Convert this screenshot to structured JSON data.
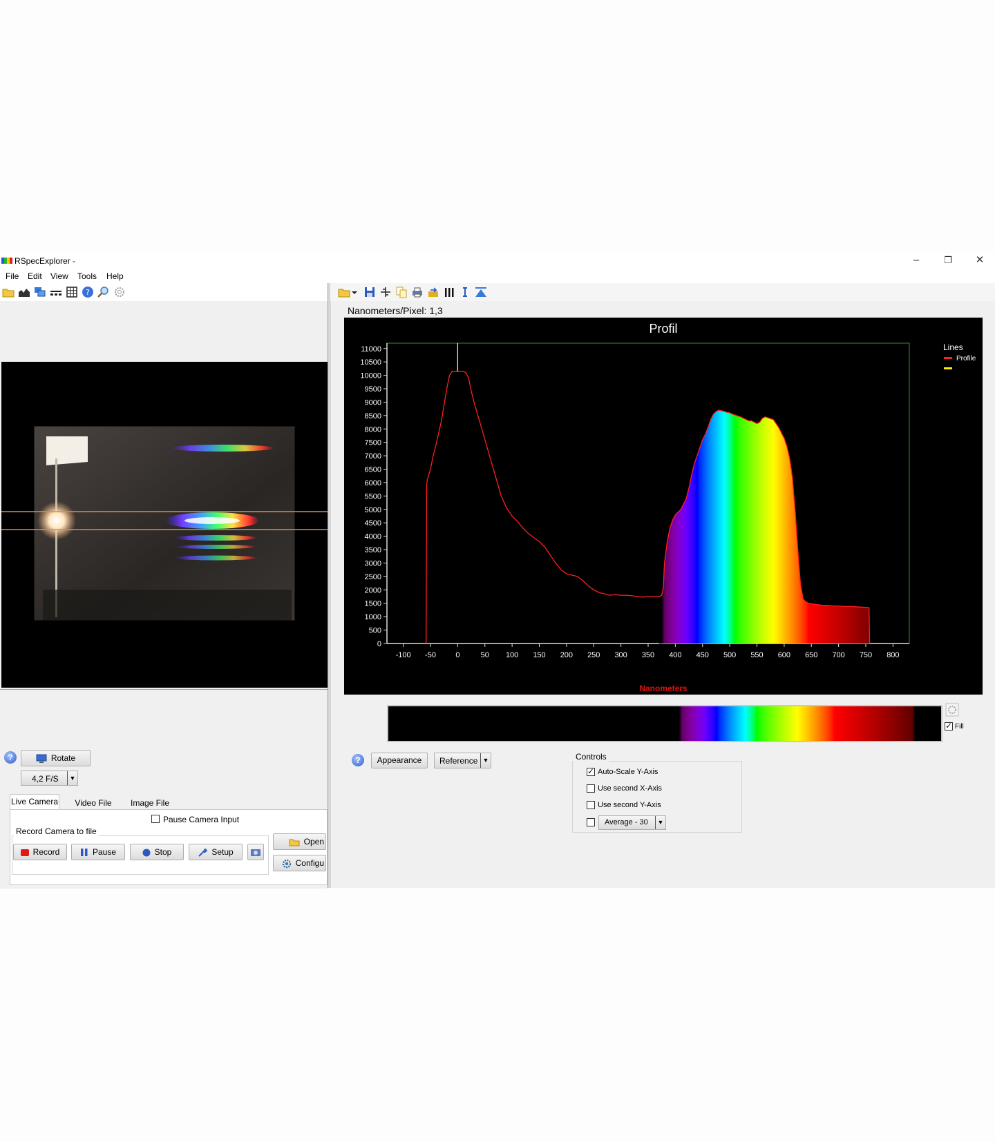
{
  "window": {
    "title": "RSpecExplorer -",
    "controls": {
      "minimize": "–",
      "restore": "❐",
      "close": "✕"
    }
  },
  "menu": [
    "File",
    "Edit",
    "View",
    "Tools",
    "Help"
  ],
  "toolbar_left_icons": [
    "open-folder-icon",
    "chart-icon",
    "windows-icon",
    "lines-icon",
    "grid-icon",
    "help-icon",
    "zoom-icon",
    "gear-icon"
  ],
  "toolbar_right_icons": [
    "open-folder-icon",
    "dropdown-icon",
    "save-icon",
    "crosshair-icon",
    "copy-icon",
    "print-icon",
    "export-icon",
    "bars-icon",
    "vertical-marker-icon",
    "peak-icon"
  ],
  "camera": {
    "rotate_label": "Rotate",
    "fps_value": "4,2 F/S",
    "tabs": [
      "Live Camera",
      "Video File",
      "Image File"
    ],
    "active_tab": 0,
    "pause_input_label": "Pause Camera Input",
    "pause_input_checked": false,
    "record_group_label": "Record Camera to file",
    "record_label": "Record",
    "pause_label": "Pause",
    "stop_label": "Stop",
    "setup_label": "Setup",
    "open_label": "Open",
    "configure_label": "Configu"
  },
  "spectrum": {
    "scale_text": "Nanometers/Pixel: 1,3",
    "appearance_label": "Appearance",
    "reference_label": "Reference",
    "fill_label": "Fill",
    "fill_checked": true,
    "controls_group_label": "Controls",
    "controls": [
      {
        "label": "Auto-Scale Y-Axis",
        "checked": true
      },
      {
        "label": "Use second X-Axis",
        "checked": false
      },
      {
        "label": "Use second Y-Axis",
        "checked": false
      }
    ],
    "average_checked": false,
    "average_value": "Average - 30"
  },
  "colors": {
    "profile_line": "#ff2020",
    "second_line": "#ffee00",
    "grid_green": "#3a8a3a",
    "axis_label_red": "#e01010"
  },
  "chart_data": {
    "type": "area",
    "title": "Profil",
    "xlabel": "Nanometers",
    "ylabel": "",
    "xlim": [
      -130,
      830
    ],
    "ylim": [
      0,
      11200
    ],
    "x_ticks": [
      -100,
      -50,
      0,
      50,
      100,
      150,
      200,
      250,
      300,
      350,
      400,
      450,
      500,
      550,
      600,
      650,
      700,
      750,
      800
    ],
    "y_ticks": [
      0,
      500,
      1000,
      1500,
      2000,
      2500,
      3000,
      3500,
      4000,
      4500,
      5000,
      5500,
      6000,
      6500,
      7000,
      7500,
      8000,
      8500,
      9000,
      9500,
      10000,
      10500,
      11000
    ],
    "legend": {
      "title": "Lines",
      "position": "top-right",
      "entries": [
        {
          "name": "Profile",
          "color": "#ff2020"
        },
        {
          "name": "",
          "color": "#ffee00"
        }
      ]
    },
    "marker_x": 0,
    "series": [
      {
        "name": "Profile",
        "x": [
          -58,
          -57,
          -56,
          -50,
          -45,
          -40,
          -30,
          -20,
          -15,
          -10,
          -5,
          0,
          5,
          10,
          15,
          20,
          25,
          30,
          40,
          50,
          60,
          70,
          80,
          90,
          100,
          110,
          120,
          130,
          140,
          150,
          160,
          170,
          180,
          190,
          200,
          210,
          220,
          230,
          240,
          250,
          260,
          270,
          280,
          290,
          300,
          310,
          320,
          330,
          340,
          350,
          360,
          370,
          375,
          378,
          380,
          385,
          390,
          395,
          400,
          405,
          410,
          415,
          420,
          425,
          430,
          435,
          440,
          445,
          450,
          455,
          460,
          465,
          470,
          475,
          480,
          485,
          490,
          495,
          500,
          505,
          510,
          515,
          520,
          525,
          530,
          535,
          540,
          545,
          550,
          555,
          560,
          565,
          570,
          575,
          580,
          585,
          590,
          595,
          600,
          605,
          610,
          615,
          620,
          625,
          630,
          635,
          640,
          645,
          650,
          655,
          660,
          670,
          680,
          690,
          700,
          710,
          720,
          730,
          740,
          750,
          755,
          756,
          757
        ],
        "y": [
          0,
          5900,
          6100,
          6500,
          7000,
          7400,
          8300,
          9500,
          10000,
          10150,
          10150,
          10150,
          10150,
          10150,
          10100,
          9900,
          9400,
          9000,
          8300,
          7600,
          6900,
          6200,
          5500,
          5050,
          4750,
          4550,
          4300,
          4100,
          3950,
          3800,
          3600,
          3300,
          3000,
          2750,
          2600,
          2550,
          2500,
          2350,
          2150,
          2000,
          1900,
          1850,
          1800,
          1820,
          1800,
          1800,
          1780,
          1750,
          1730,
          1750,
          1740,
          1750,
          1800,
          2100,
          3000,
          3800,
          4300,
          4600,
          4800,
          4900,
          5000,
          5200,
          5400,
          5800,
          6300,
          6700,
          7000,
          7300,
          7600,
          7800,
          8050,
          8350,
          8550,
          8650,
          8700,
          8680,
          8650,
          8620,
          8600,
          8550,
          8520,
          8480,
          8450,
          8400,
          8350,
          8300,
          8300,
          8250,
          8200,
          8250,
          8400,
          8450,
          8420,
          8380,
          8350,
          8200,
          8050,
          7850,
          7650,
          7350,
          6900,
          6200,
          5000,
          3500,
          2200,
          1650,
          1550,
          1500,
          1480,
          1470,
          1450,
          1430,
          1420,
          1400,
          1400,
          1380,
          1380,
          1370,
          1360,
          1350,
          1340,
          1340,
          0
        ]
      }
    ]
  }
}
